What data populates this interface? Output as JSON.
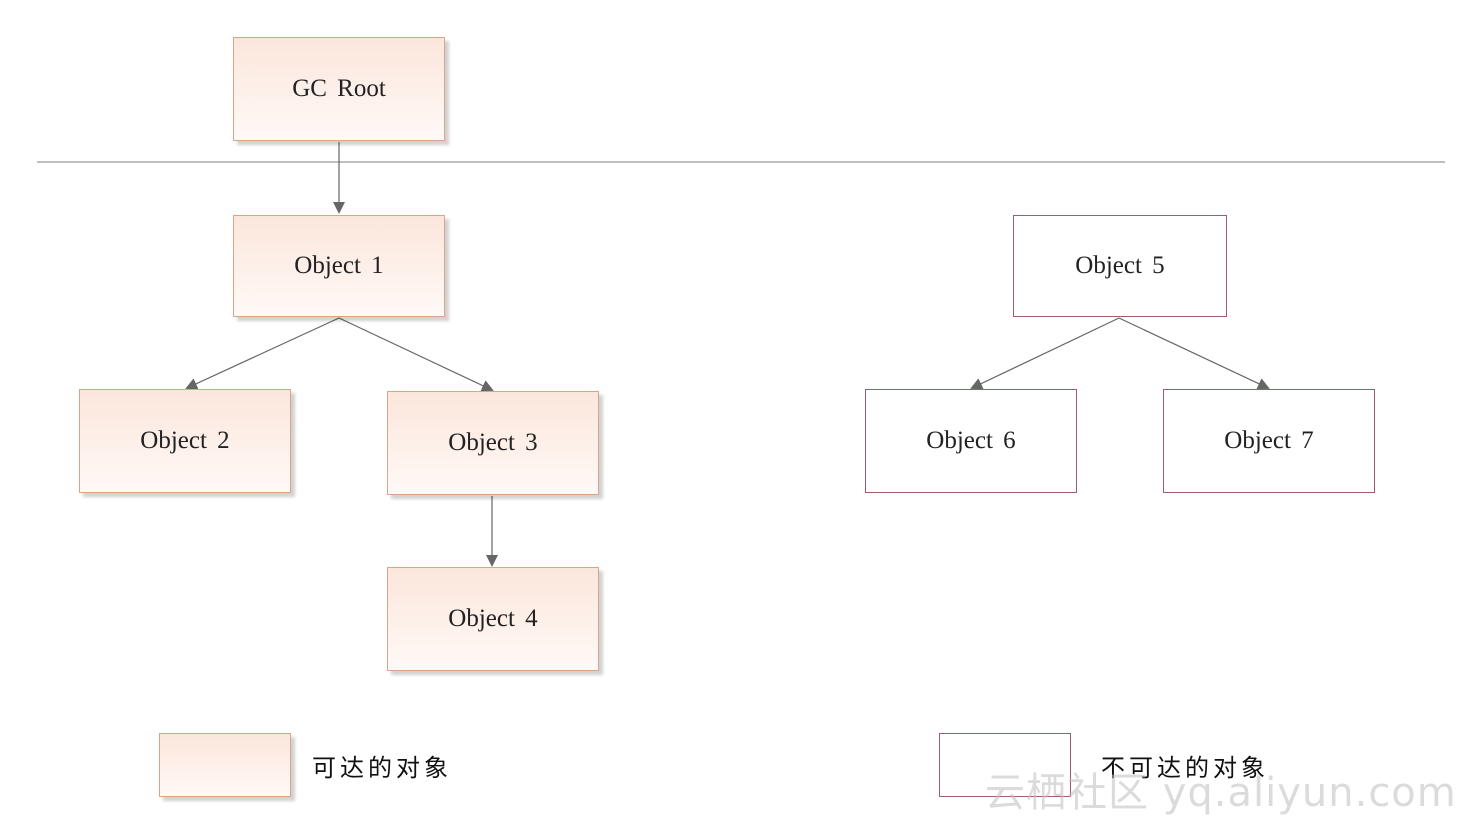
{
  "nodes": {
    "root": "GC Root",
    "obj1": "Object 1",
    "obj2": "Object 2",
    "obj3": "Object 3",
    "obj4": "Object 4",
    "obj5": "Object 5",
    "obj6": "Object 6",
    "obj7": "Object 7"
  },
  "edges": [
    {
      "from": "GC Root",
      "to": "Object 1"
    },
    {
      "from": "Object 1",
      "to": "Object 2"
    },
    {
      "from": "Object 1",
      "to": "Object 3"
    },
    {
      "from": "Object 3",
      "to": "Object 4"
    },
    {
      "from": "Object 5",
      "to": "Object 6"
    },
    {
      "from": "Object 5",
      "to": "Object 7"
    }
  ],
  "legend": {
    "reachable": "可达的对象",
    "unreachable": "不可达的对象"
  },
  "watermark": "云栖社区 yq.aliyun.com",
  "colors": {
    "reachable_border": "#d9a589",
    "reachable_fill": "#fbe6dc",
    "unreachable_border": "#a15d6a",
    "edge": "#666666",
    "divider": "#aaaaaa"
  }
}
